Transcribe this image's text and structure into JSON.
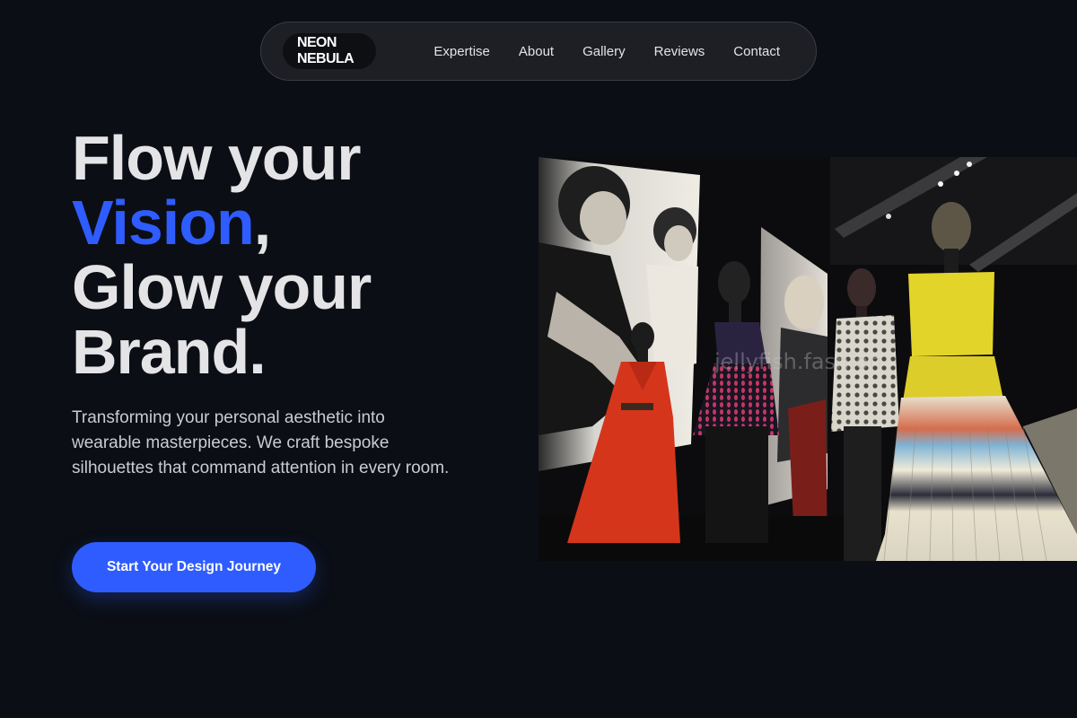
{
  "nav": {
    "brand": "NEON NEBULA",
    "links": [
      "Expertise",
      "About",
      "Gallery",
      "Reviews",
      "Contact"
    ]
  },
  "hero": {
    "headline": {
      "line1": "Flow your",
      "line2_accent": "Vision",
      "line2_rest": ",",
      "line3": "Glow your",
      "line4": "Brand."
    },
    "description": "Transforming your personal aesthetic into wearable masterpieces. We craft bespoke silhouettes that command attention in every room.",
    "cta_label": "Start Your Design Journey",
    "image": {
      "subject": "fashion-exhibition-mannequins-photo",
      "watermark": "jellyfish.fashion"
    }
  },
  "colors": {
    "background": "#0b0e15",
    "accent": "#2f5cff",
    "nav_bg": "#1d1f24",
    "text": "#e4e4e6"
  }
}
